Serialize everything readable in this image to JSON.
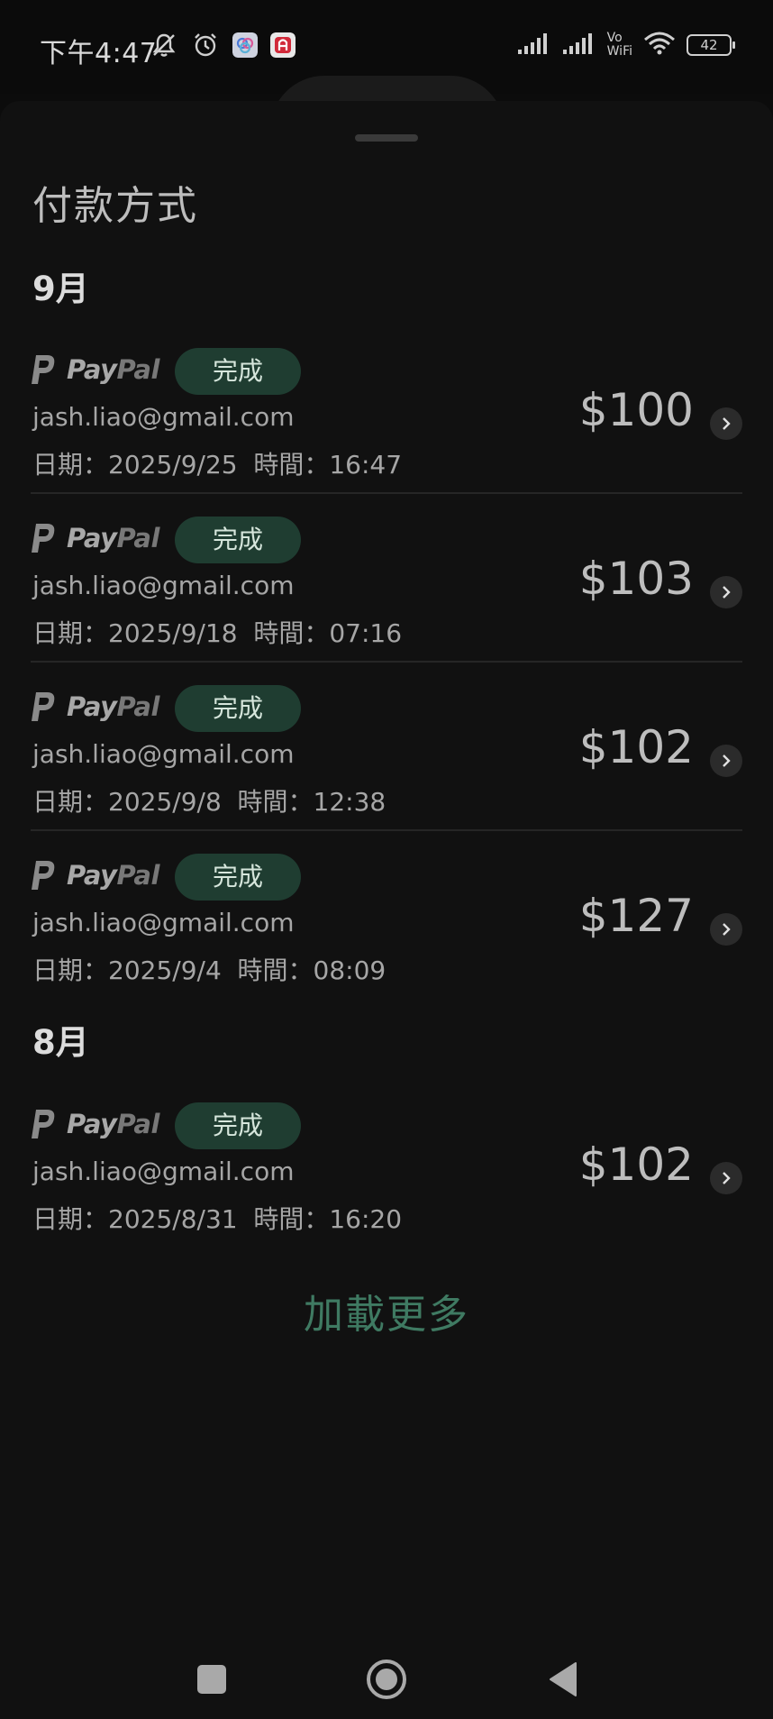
{
  "status_bar": {
    "time": "下午4:47",
    "battery": "42",
    "network_label_top": "Vo",
    "network_label_bottom": "WiFi",
    "icons": [
      "mute-icon",
      "alarm-icon",
      "app-notification-icon",
      "app-notification-icon",
      "cell-signal-icon",
      "cell-signal-icon",
      "wifi-icon",
      "battery-icon"
    ]
  },
  "sheet": {
    "title": "付款方式",
    "load_more": "加載更多"
  },
  "groups": [
    {
      "month": "9月",
      "items": [
        {
          "method": "PayPal",
          "status": "完成",
          "email": "jash.liao@gmail.com",
          "datetime": "日期：2025/9/25  時間：16:47",
          "amount": "$100"
        },
        {
          "method": "PayPal",
          "status": "完成",
          "email": "jash.liao@gmail.com",
          "datetime": "日期：2025/9/18  時間：07:16",
          "amount": "$103"
        },
        {
          "method": "PayPal",
          "status": "完成",
          "email": "jash.liao@gmail.com",
          "datetime": "日期：2025/9/8  時間：12:38",
          "amount": "$102"
        },
        {
          "method": "PayPal",
          "status": "完成",
          "email": "jash.liao@gmail.com",
          "datetime": "日期：2025/9/4  時間：08:09",
          "amount": "$127"
        }
      ]
    },
    {
      "month": "8月",
      "items": [
        {
          "method": "PayPal",
          "status": "完成",
          "email": "jash.liao@gmail.com",
          "datetime": "日期：2025/8/31  時間：16:20",
          "amount": "$102"
        }
      ]
    }
  ],
  "colors": {
    "background": "#111111",
    "status_pill_bg": "#1f3d31",
    "load_more": "#3f7a62"
  }
}
